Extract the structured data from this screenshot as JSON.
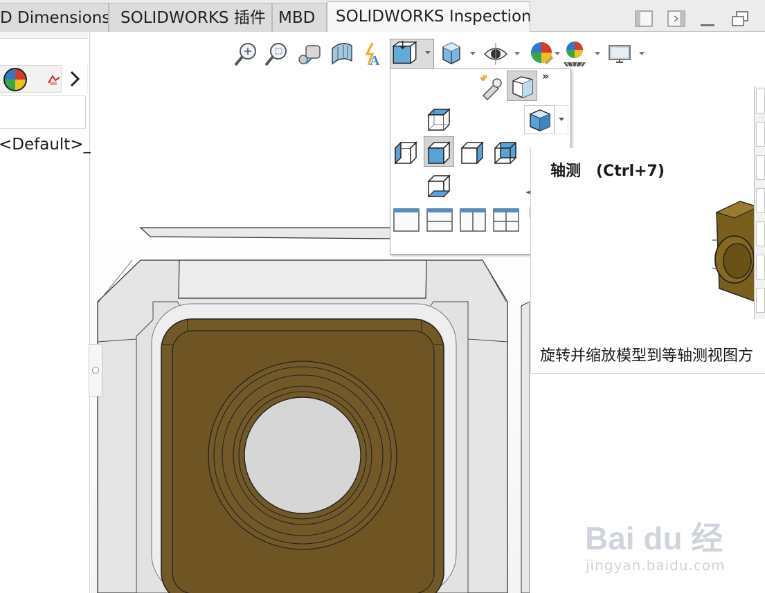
{
  "tabs": [
    {
      "label": "D Dimensions",
      "active": false
    },
    {
      "label": "SOLIDWORKS 插件",
      "active": false
    },
    {
      "label": "MBD",
      "active": false
    },
    {
      "label": "SOLIDWORKS Inspection",
      "active": true
    }
  ],
  "left_panel": {
    "configuration_text": "<Default>_P"
  },
  "heads_up_toolbar": [
    {
      "icon": "zoom-to-fit-icon"
    },
    {
      "icon": "zoom-to-area-icon"
    },
    {
      "icon": "previous-view-icon"
    },
    {
      "icon": "section-view-icon"
    },
    {
      "icon": "dynamic-annotation-views-icon"
    },
    {
      "icon": "view-orientation-icon",
      "dropdown": true,
      "selected": true
    },
    {
      "icon": "display-style-icon",
      "dropdown": true
    },
    {
      "icon": "hide-show-items-icon",
      "dropdown": true
    },
    {
      "icon": "edit-appearance-icon",
      "dropdown": true
    },
    {
      "icon": "apply-scene-icon",
      "dropdown": true
    },
    {
      "icon": "view-settings-icon",
      "dropdown": true
    }
  ],
  "flyout": {
    "more_label": "»",
    "items": [
      "view-selector-icon",
      "normal-to-icon",
      "isometric-icon",
      "top-view-icon",
      "left-view-icon",
      "front-view-icon",
      "right-view-icon",
      "back-view-icon",
      "bottom-view-icon",
      "single-viewport-icon",
      "two-view-horizontal-icon",
      "two-view-vertical-icon",
      "four-view-icon",
      "link-views-icon"
    ]
  },
  "tooltip": {
    "title": "轴测　(Ctrl+7)",
    "description": "旋转并缩放模型到等轴测视图方"
  },
  "watermark": {
    "brand": "Bai du 经验",
    "url": "jingyan.baidu.com"
  },
  "colors": {
    "model_face": "#735927",
    "model_frame": "#e4e4e4",
    "accent_blue": "#3a8fc7"
  }
}
